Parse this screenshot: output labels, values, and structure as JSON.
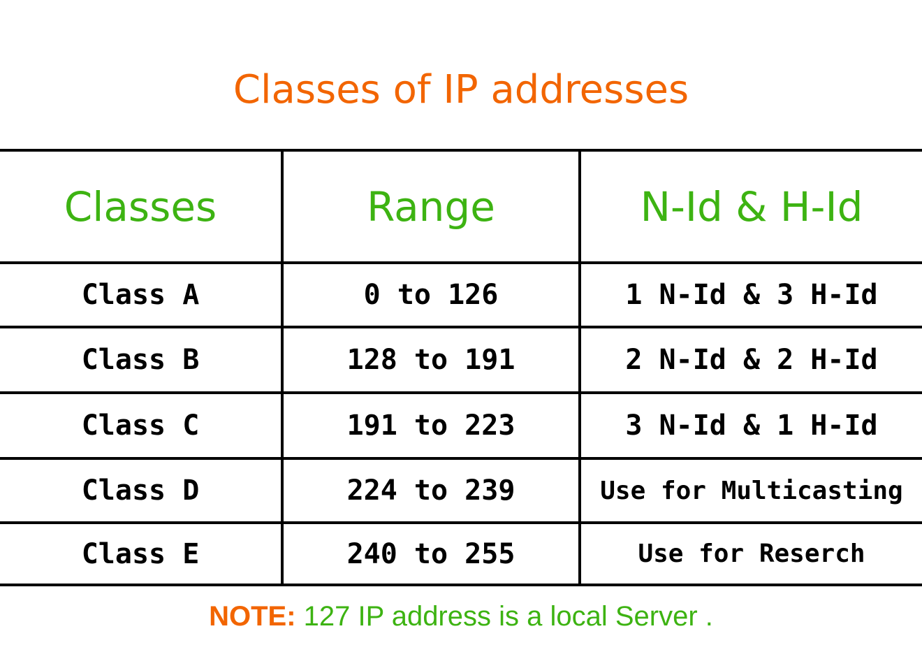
{
  "title": "Classes of IP addresses",
  "table": {
    "headers": [
      "Classes",
      "Range",
      "N-Id & H-Id"
    ],
    "rows": [
      [
        "Class A",
        "0 to 126",
        "1 N-Id & 3 H-Id"
      ],
      [
        "Class B",
        "128 to 191",
        "2 N-Id & 2 H-Id"
      ],
      [
        "Class C",
        "191 to 223",
        "3 N-Id & 1 H-Id"
      ],
      [
        "Class D",
        "224 to 239",
        "Use for Multicasting"
      ],
      [
        "Class E",
        "240 to 255",
        "Use for Reserch"
      ]
    ]
  },
  "note": {
    "label": "NOTE:",
    "text": " 127 IP address is a local Server ."
  },
  "colors": {
    "title": "#f26500",
    "header": "#3db312",
    "note_label": "#f26500",
    "note_text": "#3db312"
  }
}
